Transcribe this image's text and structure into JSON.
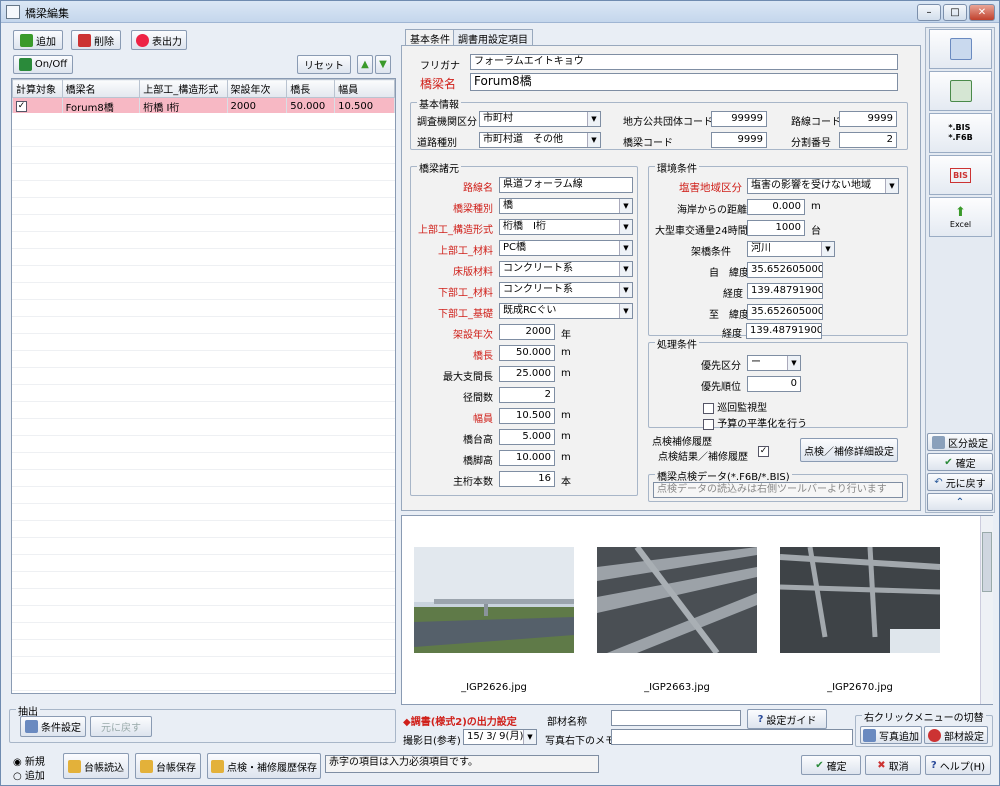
{
  "window": {
    "title": "橋梁編集",
    "min": "–",
    "max": "□",
    "close": "✕"
  },
  "toolbar": {
    "add": "追加",
    "delete": "削除",
    "output": "表出力",
    "onoff": "On/Off",
    "reset": "リセット"
  },
  "table": {
    "headers": [
      "計算対象",
      "橋梁名",
      "上部工_構造形式",
      "架設年次",
      "橋長",
      "幅員"
    ],
    "rows": [
      {
        "check": "✓",
        "name": "Forum8橋",
        "struct": "桁橋 I桁",
        "year": "2000",
        "length": "50.000",
        "width": "10.500"
      }
    ]
  },
  "extract": {
    "title": "抽出",
    "cond": "条件設定",
    "back": "元に戻す"
  },
  "bottom": {
    "new": "新規",
    "add": "追加",
    "load": "台帳読込",
    "save": "台帳保存",
    "hist": "点検・補修履歴保存",
    "status": "赤字の項目は入力必須項目です。",
    "ok": "確定",
    "cancel": "取消",
    "help": "ヘルプ(H)"
  },
  "tabs": [
    "基本条件",
    "調書用設定項目"
  ],
  "basic": {
    "furigana_label": "フリガナ",
    "furigana": "フォーラムエイトキョウ",
    "name_label": "橋梁名",
    "name": "Forum8橋"
  },
  "kihon": {
    "title": "基本情報",
    "org_label": "調査機関区分",
    "org": "市町村",
    "pubcode_label": "地方公共団体コード",
    "pubcode": "99999",
    "route_label": "路線コード",
    "route": "9999",
    "roadtype_label": "道路種別",
    "roadtype": "市町村道　その他",
    "bridgecode_label": "橋梁コード",
    "bridgecode": "9999",
    "split_label": "分割番号",
    "split": "2"
  },
  "shogen": {
    "title": "橋梁諸元",
    "rows": [
      {
        "label": "路線名",
        "value": "県道フォーラム線",
        "red": true,
        "type": "text"
      },
      {
        "label": "橋梁種別",
        "value": "橋",
        "red": true,
        "type": "sel"
      },
      {
        "label": "上部工_構造形式",
        "value": "桁橋　I桁",
        "red": true,
        "type": "sel"
      },
      {
        "label": "上部工_材料",
        "value": "PC橋",
        "red": true,
        "type": "sel"
      },
      {
        "label": "床版材料",
        "value": "コンクリート系",
        "red": true,
        "type": "sel"
      },
      {
        "label": "下部工_材料",
        "value": "コンクリート系",
        "red": true,
        "type": "sel"
      },
      {
        "label": "下部工_基礎",
        "value": "既成RCぐい",
        "red": true,
        "type": "sel"
      }
    ],
    "nums": [
      {
        "label": "架設年次",
        "value": "2000",
        "unit": "年",
        "red": true
      },
      {
        "label": "橋長",
        "value": "50.000",
        "unit": "m",
        "red": true
      },
      {
        "label": "最大支間長",
        "value": "25.000",
        "unit": "m",
        "red": false
      },
      {
        "label": "径間数",
        "value": "2",
        "unit": "",
        "red": false
      },
      {
        "label": "幅員",
        "value": "10.500",
        "unit": "m",
        "red": true
      },
      {
        "label": "橋台高",
        "value": "5.000",
        "unit": "m",
        "red": false
      },
      {
        "label": "橋脚高",
        "value": "10.000",
        "unit": "m",
        "red": false
      },
      {
        "label": "主桁本数",
        "value": "16",
        "unit": "本",
        "red": false
      }
    ]
  },
  "kankyo": {
    "title": "環境条件",
    "salt_label": "塩害地域区分",
    "salt": "塩害の影響を受けない地域",
    "sea_label": "海岸からの距離",
    "sea": "0.000",
    "sea_unit": "m",
    "traffic_label": "大型車交通量24時間",
    "traffic": "1000",
    "traffic_unit": "台",
    "cross_label": "架橋条件",
    "cross": "河川",
    "from_lat_label": "自　緯度",
    "from_lat": "35.652605000",
    "from_lon_label": "経度",
    "from_lon": "139.487919000",
    "to_lat_label": "至　緯度",
    "to_lat": "35.652605000",
    "to_lon_label": "経度",
    "to_lon": "139.487919000"
  },
  "shori": {
    "title": "処理条件",
    "prio_label": "優先区分",
    "prio": "ー",
    "order_label": "優先順位",
    "order": "0",
    "patrol": "巡回監視型",
    "budget": "予算の平準化を行う"
  },
  "tenken": {
    "title": "点検補修履歴",
    "result_label": "点検結果／補修履歴",
    "result_check": "✓",
    "detail": "点検／補修詳細設定"
  },
  "data": {
    "title": "橋梁点検データ(*.F6B/*.BIS)",
    "placeholder": "点検データの読込みは右側ツールバーより行います"
  },
  "side": {
    "bis_f6b": "*.BIS\n*.F6B",
    "bis": "BIS",
    "excel": "Excel",
    "kubun": "区分設定",
    "kakutei": "確定",
    "modoru": "元に戻す",
    "up": "⌃"
  },
  "photos": [
    {
      "name": "_IGP2626.jpg"
    },
    {
      "name": "_IGP2663.jpg"
    },
    {
      "name": "_IGP2670.jpg"
    }
  ],
  "photobar": {
    "output_label": "◆調書(様式2)の出力設定",
    "part_label": "部材名称",
    "guide": "設定ガイド",
    "date_label": "撮影日(参考)",
    "date": "15/ 3/ 9(月)",
    "memo_label": "写真右下のメモ",
    "menu_title": "右クリックメニューの切替",
    "photo_add": "写真追加",
    "part_set": "部材設定"
  },
  "colors": {
    "row_highlight": "#f7b8c4",
    "accent": "#d0201a",
    "green": "#3a9a2a"
  }
}
